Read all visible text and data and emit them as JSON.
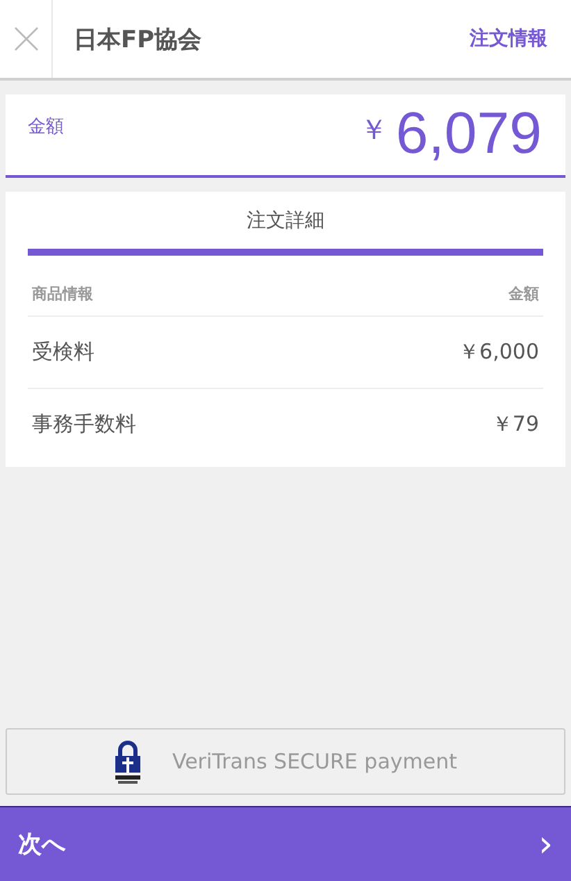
{
  "header": {
    "title": "日本FP協会",
    "link": "注文情報"
  },
  "amount": {
    "label": "金額",
    "currency": "￥",
    "value": "6,079"
  },
  "details": {
    "tabs": [
      {
        "label": "注文詳細",
        "selected": true
      }
    ],
    "columns": [
      "商品情報",
      "金額"
    ],
    "rows": [
      {
        "name": "受検料",
        "price": "￥6,000"
      },
      {
        "name": "事務手数料",
        "price": "￥79"
      }
    ]
  },
  "secure": {
    "text": "VeriTrans SECURE payment"
  },
  "footer": {
    "button": "次へ",
    "arrow": "›"
  }
}
